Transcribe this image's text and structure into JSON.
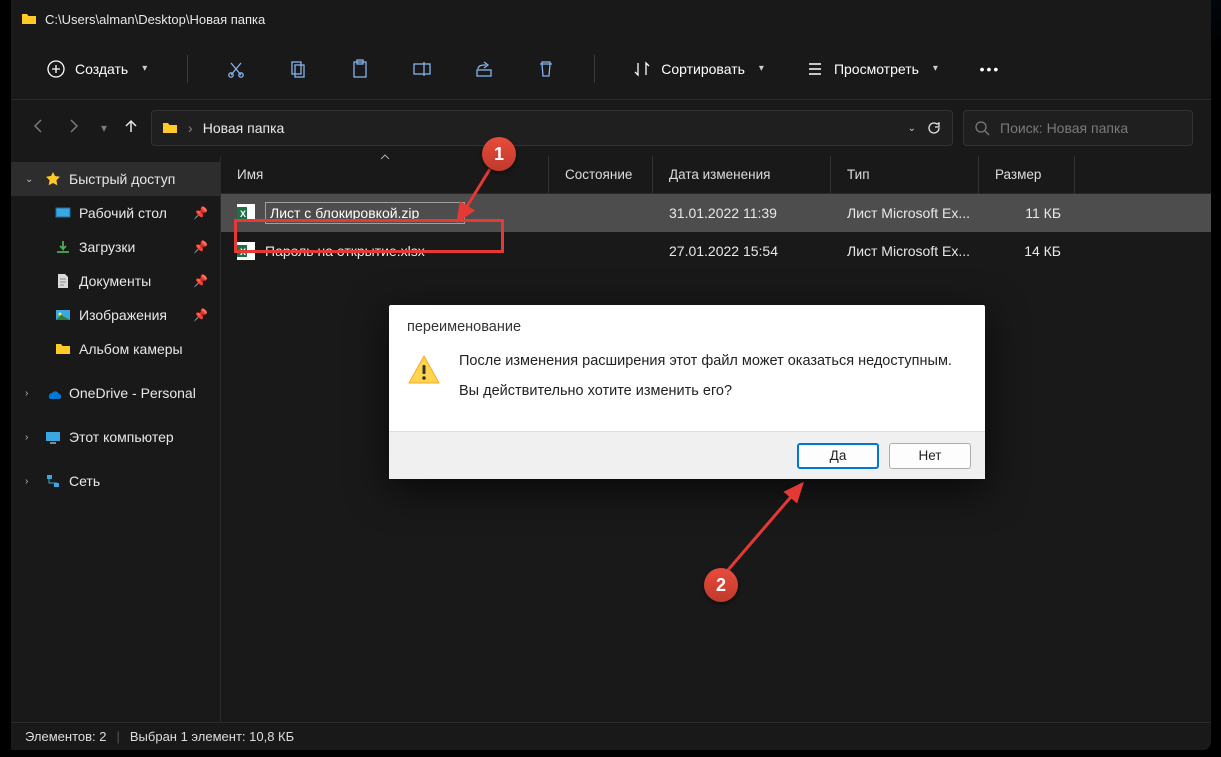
{
  "titlebar": {
    "path": "C:\\Users\\alman\\Desktop\\Новая папка"
  },
  "toolbar": {
    "new_label": "Создать",
    "sort_label": "Сортировать",
    "view_label": "Просмотреть"
  },
  "addressbar": {
    "current": "Новая папка"
  },
  "search": {
    "placeholder": "Поиск: Новая папка"
  },
  "sidebar": {
    "quick_access": "Быстрый доступ",
    "items": [
      {
        "label": "Рабочий стол",
        "pinned": true
      },
      {
        "label": "Загрузки",
        "pinned": true
      },
      {
        "label": "Документы",
        "pinned": true
      },
      {
        "label": "Изображения",
        "pinned": true
      },
      {
        "label": "Альбом камеры",
        "pinned": false
      }
    ],
    "onedrive": "OneDrive - Personal",
    "this_pc": "Этот компьютер",
    "network": "Сеть"
  },
  "columns": {
    "name": "Имя",
    "state": "Состояние",
    "date": "Дата изменения",
    "type": "Тип",
    "size": "Размер"
  },
  "files": [
    {
      "name": "Лист с блокировкой.zip",
      "date": "31.01.2022 11:39",
      "type": "Лист Microsoft Ex...",
      "size": "11 КБ",
      "renaming": true,
      "selected": true
    },
    {
      "name": "Пароль на открытие.xlsx",
      "date": "27.01.2022 15:54",
      "type": "Лист Microsoft Ex...",
      "size": "14 КБ",
      "renaming": false,
      "selected": false
    }
  ],
  "dialog": {
    "title": "переименование",
    "line1": "После изменения расширения этот файл может оказаться недоступным.",
    "line2": "Вы действительно хотите изменить его?",
    "yes": "Да",
    "no": "Нет"
  },
  "statusbar": {
    "count": "Элементов: 2",
    "selection": "Выбран 1 элемент: 10,8 КБ"
  },
  "annotations": {
    "marker1": "1",
    "marker2": "2"
  }
}
